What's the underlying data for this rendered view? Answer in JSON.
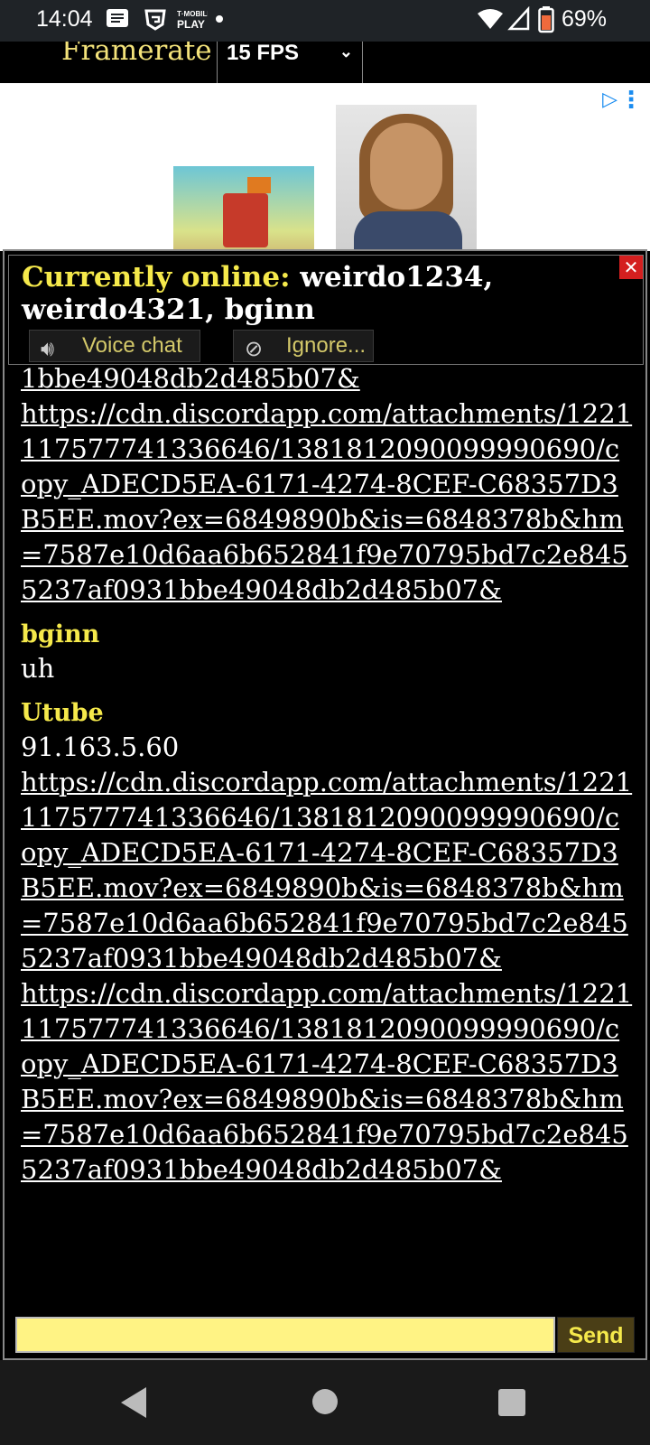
{
  "status_bar": {
    "time": "14:04",
    "icons": [
      "message-icon",
      "gaming-icon",
      "tmobile-play-icon",
      "dot-icon",
      "wifi-icon",
      "signal-icon",
      "battery-icon"
    ],
    "tmobile_label": "T-MOBILE PLAY",
    "battery": "69%"
  },
  "page": {
    "framerate_label": "Framerate",
    "framerate_value": "15 FPS"
  },
  "ad": {
    "choices_icon": "ad-choices-icon",
    "menu_icon": "more-vertical-icon"
  },
  "chat": {
    "online_label": "Currently online:",
    "online_users": " weirdo1234, weirdo4321, bginn",
    "close_label": "✕",
    "voice_chat_label": "Voice chat",
    "ignore_label": "Ignore...",
    "messages": {
      "m0_tail": "1bbe49048db2d485b07&",
      "m0_link": "https://cdn.discordapp.com/attachments/1221117577741336646/1381812090099990690/copy_ADECD5EA-6171-4274-8CEF-C68357D3B5EE.mov?ex=6849890b&is=6848378b&hm=7587e10d6aa6b652841f9e70795bd7c2e8455237af0931bbe49048db2d485b07&",
      "m1_sender": "bginn",
      "m1_text": "uh",
      "m2_sender": "Utube",
      "m2_text": "91.163.5.60",
      "m2_link1": "https://cdn.discordapp.com/attachments/1221117577741336646/1381812090099990690/copy_ADECD5EA-6171-4274-8CEF-C68357D3B5EE.mov?ex=6849890b&is=6848378b&hm=7587e10d6aa6b652841f9e70795bd7c2e8455237af0931bbe49048db2d485b07&",
      "m2_link2": "https://cdn.discordapp.com/attachments/1221117577741336646/1381812090099990690/copy_ADECD5EA-6171-4274-8CEF-C68357D3B5EE.mov?ex=6849890b&is=6848378b&hm=7587e10d6aa6b652841f9e70795bd7c2e8455237af0931bbe49048db2d485b07&"
    },
    "input_value": "",
    "send_label": "Send"
  },
  "nav": {
    "back_icon": "back-icon",
    "home_icon": "home-icon",
    "recents_icon": "recents-icon"
  },
  "colors": {
    "accent_yellow": "#f5e94b",
    "input_yellow": "#fff384",
    "close_red": "#d41f1f"
  }
}
